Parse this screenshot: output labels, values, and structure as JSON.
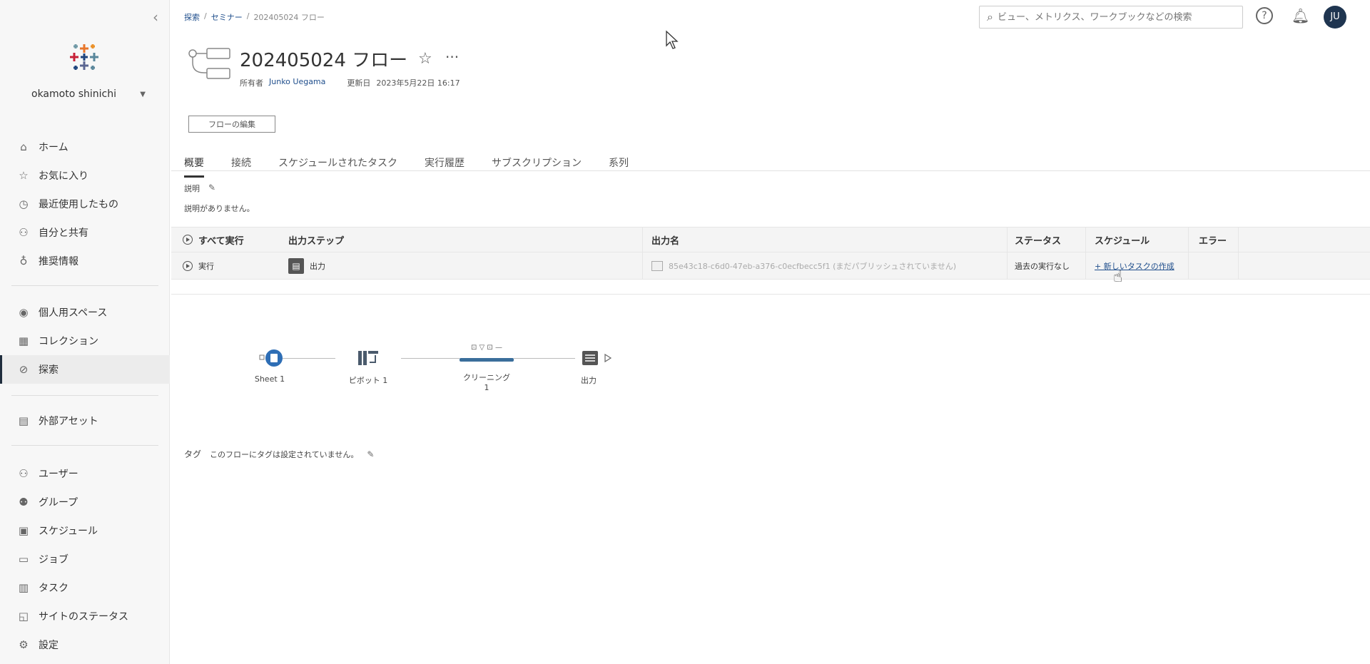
{
  "breadcrumb": {
    "items": [
      "探索",
      "セミナー",
      "202405024 フロー"
    ],
    "separator": "/"
  },
  "search": {
    "placeholder": "ビュー、メトリクス、ワークブックなどの検索"
  },
  "avatar": {
    "initials": "JU",
    "color": "#1f3550"
  },
  "sidebar": {
    "user_name": "okamoto shinichi",
    "items_top": [
      {
        "label": "ホーム",
        "icon": "home-icon"
      },
      {
        "label": "お気に入り",
        "icon": "star-icon"
      },
      {
        "label": "最近使用したもの",
        "icon": "clock-icon"
      },
      {
        "label": "自分と共有",
        "icon": "shared-icon"
      },
      {
        "label": "推奨情報",
        "icon": "lightbulb-icon"
      }
    ],
    "items_mid": [
      {
        "label": "個人用スペース",
        "icon": "person-icon"
      },
      {
        "label": "コレクション",
        "icon": "collection-icon"
      },
      {
        "label": "探索",
        "icon": "compass-icon",
        "active": true
      }
    ],
    "items_ext": [
      {
        "label": "外部アセット",
        "icon": "external-assets-icon"
      }
    ],
    "items_admin": [
      {
        "label": "ユーザー",
        "icon": "users-icon"
      },
      {
        "label": "グループ",
        "icon": "groups-icon"
      },
      {
        "label": "スケジュール",
        "icon": "calendar-icon"
      },
      {
        "label": "ジョブ",
        "icon": "jobs-icon"
      },
      {
        "label": "タスク",
        "icon": "tasks-icon"
      },
      {
        "label": "サイトのステータス",
        "icon": "site-status-icon"
      },
      {
        "label": "設定",
        "icon": "settings-icon"
      }
    ]
  },
  "header": {
    "title": "202405024 フロー",
    "owner_label": "所有者",
    "owner": "Junko Uegama",
    "updated_label": "更新日",
    "updated": "2023年5月22日 16:17",
    "edit_button": "フローの編集"
  },
  "tabs": [
    "概要",
    "接続",
    "スケジュールされたタスク",
    "実行履歴",
    "サブスクリプション",
    "系列"
  ],
  "description": {
    "label": "説明",
    "text": "説明がありません。"
  },
  "table": {
    "headers": {
      "run_all": "すべて実行",
      "output_step": "出力ステップ",
      "output_name": "出力名",
      "status": "ステータス",
      "schedule": "スケジュール",
      "error": "エラー"
    },
    "rows": [
      {
        "run": "実行",
        "step": "出力",
        "output_name": "85e43c18-c6d0-47eb-a376-c0ecfbecc5f1 (まだパブリッシュされていません)",
        "status": "過去の実行なし",
        "schedule_link": "+ 新しいタスクの作成",
        "error": ""
      }
    ]
  },
  "flow": {
    "nodes": [
      "Sheet 1",
      "ピボット 1",
      "クリーニング 1",
      "出力"
    ]
  },
  "tags": {
    "label": "タグ",
    "text": "このフローにタグは設定されていません。"
  }
}
